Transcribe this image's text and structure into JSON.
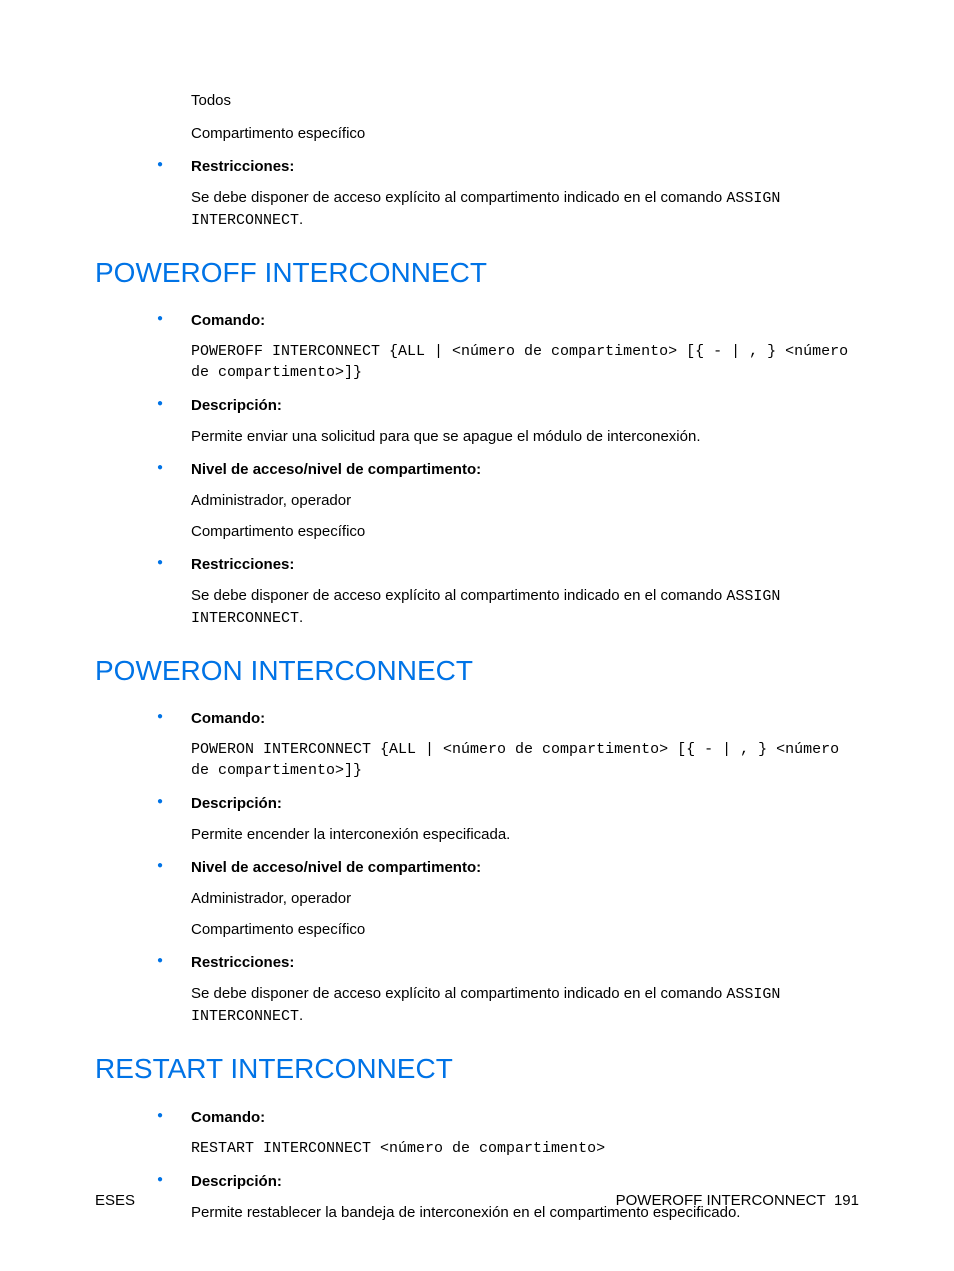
{
  "labels": {
    "comando": "Comando:",
    "descripcion": "Descripción:",
    "nivel": "Nivel de acceso/nivel de compartimento:",
    "restricciones": "Restricciones:"
  },
  "intro": {
    "todos": "Todos",
    "comp_especifico": "Compartimento específico",
    "restr_text_prefix": "Se debe disponer de acceso explícito al compartimento indicado en el comando ",
    "restr_code": "ASSIGN INTERCONNECT",
    "restr_suffix": "."
  },
  "sections": [
    {
      "heading": "POWEROFF INTERCONNECT",
      "comando_code": "POWEROFF INTERCONNECT {ALL | <número de compartimento> [{ - | , } <número de compartimento>]}",
      "descripcion": "Permite enviar una solicitud para que se apague el módulo de interconexión.",
      "nivel_1": "Administrador, operador",
      "nivel_2": "Compartimento específico",
      "restr_prefix": "Se debe disponer de acceso explícito al compartimento indicado en el comando ",
      "restr_code": "ASSIGN INTERCONNECT",
      "restr_suffix": "."
    },
    {
      "heading": "POWERON INTERCONNECT",
      "comando_code": "POWERON INTERCONNECT {ALL | <número de compartimento> [{ - | , } <número de compartimento>]}",
      "descripcion": "Permite encender la interconexión especificada.",
      "nivel_1": "Administrador, operador",
      "nivel_2": "Compartimento específico",
      "restr_prefix": "Se debe disponer de acceso explícito al compartimento indicado en el comando ",
      "restr_code": "ASSIGN INTERCONNECT",
      "restr_suffix": "."
    },
    {
      "heading": "RESTART INTERCONNECT",
      "comando_code": "RESTART INTERCONNECT <número de compartimento>",
      "descripcion": "Permite restablecer la bandeja de interconexión en el compartimento especificado."
    }
  ],
  "footer": {
    "left": "ESES",
    "right_label": "POWEROFF INTERCONNECT",
    "page": "191"
  }
}
